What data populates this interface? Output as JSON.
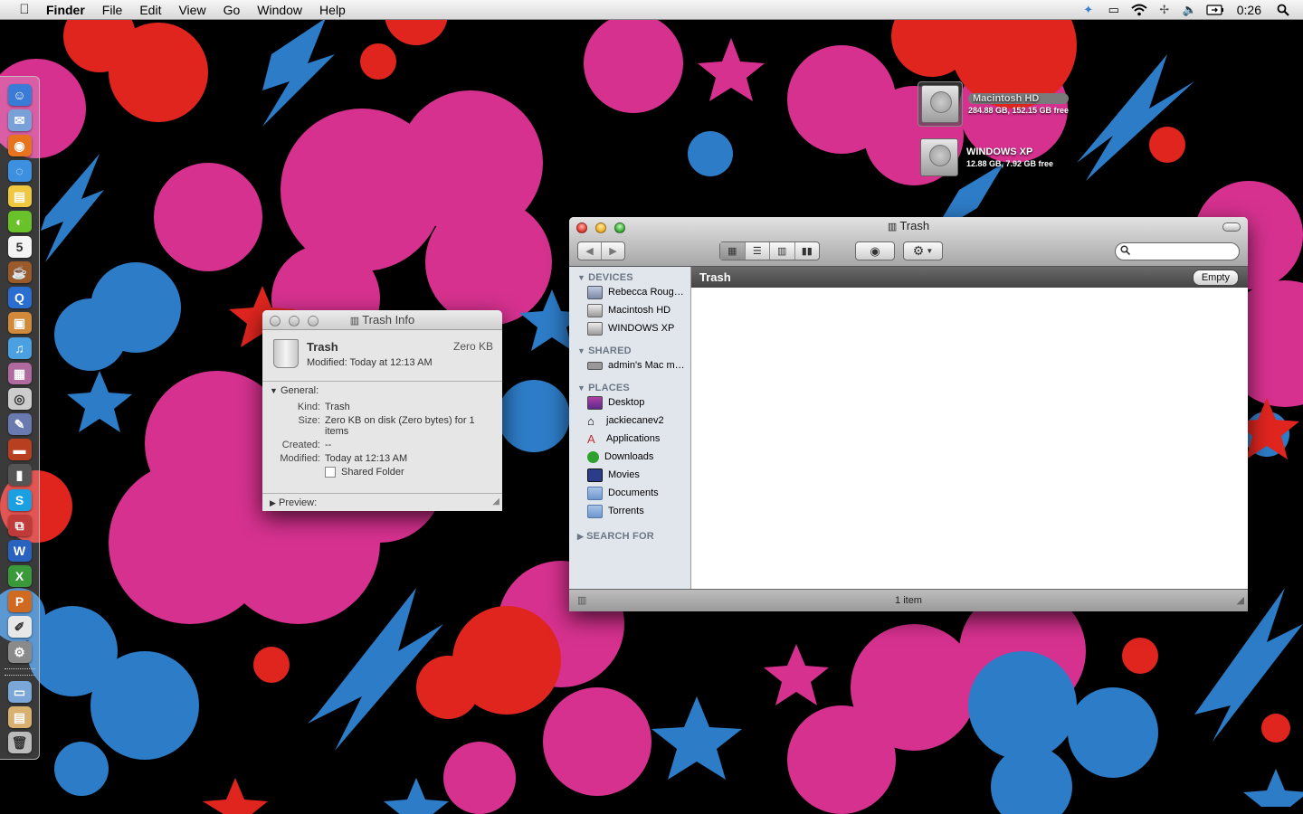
{
  "menubar": {
    "app": "Finder",
    "items": [
      "File",
      "Edit",
      "View",
      "Go",
      "Window",
      "Help"
    ],
    "clock": "0:26",
    "status_icons": [
      "dropbox-icon",
      "display-icon",
      "wifi-icon",
      "bluetooth-icon",
      "volume-icon",
      "battery-icon",
      "spotlight-icon"
    ]
  },
  "desktop": {
    "drives": [
      {
        "name": "Macintosh HD",
        "size": "284.88 GB, 152.15 GB free"
      },
      {
        "name": "WINDOWS XP",
        "size": "12.88 GB, 7.92 GB free"
      }
    ]
  },
  "dock": {
    "icons": [
      {
        "name": "finder-icon",
        "glyph": "☺",
        "color": "#3b7bd8"
      },
      {
        "name": "mail-stamp-icon",
        "glyph": "✉",
        "color": "#7aa0d8"
      },
      {
        "name": "firefox-icon",
        "glyph": "◉",
        "color": "#e8731f"
      },
      {
        "name": "ichat-icon",
        "glyph": "◌",
        "color": "#3d8fe0"
      },
      {
        "name": "printer-icon",
        "glyph": "▤",
        "color": "#f0c840"
      },
      {
        "name": "limewire-icon",
        "glyph": "◐",
        "color": "#6ac22a"
      },
      {
        "name": "ical-icon",
        "glyph": "5",
        "color": "#f4f4f4"
      },
      {
        "name": "coffee-icon",
        "glyph": "☕",
        "color": "#9a5a2a"
      },
      {
        "name": "quicktime-icon",
        "glyph": "Q",
        "color": "#2a6ed0"
      },
      {
        "name": "iphoto-icon",
        "glyph": "▣",
        "color": "#d08a3a"
      },
      {
        "name": "itunes-icon",
        "glyph": "♫",
        "color": "#4aa0e0"
      },
      {
        "name": "system-utility-icon",
        "glyph": "▦",
        "color": "#b06aa0"
      },
      {
        "name": "dvd-player-icon",
        "glyph": "◎",
        "color": "#cccccc"
      },
      {
        "name": "preview-icon",
        "glyph": "✎",
        "color": "#6a7ab0"
      },
      {
        "name": "photo-booth-icon",
        "glyph": "▬",
        "color": "#b84020"
      },
      {
        "name": "imovie-icon",
        "glyph": "▮",
        "color": "#555555"
      },
      {
        "name": "skype-icon",
        "glyph": "S",
        "color": "#1aa0e0"
      },
      {
        "name": "vmware-icon",
        "glyph": "⧉",
        "color": "#c03a3a"
      },
      {
        "name": "word-icon",
        "glyph": "W",
        "color": "#2a62c0"
      },
      {
        "name": "excel-icon",
        "glyph": "X",
        "color": "#3a9a3a"
      },
      {
        "name": "powerpoint-icon",
        "glyph": "P",
        "color": "#d06a20"
      },
      {
        "name": "textedit-icon",
        "glyph": "✐",
        "color": "#e8e8e8"
      },
      {
        "name": "system-preferences-icon",
        "glyph": "⚙",
        "color": "#8a8a8a"
      }
    ],
    "stack_icons": [
      {
        "name": "documents-folder-icon",
        "glyph": "▭",
        "color": "#7aa6d8"
      },
      {
        "name": "downloads-stack-icon",
        "glyph": "▤",
        "color": "#d8b070"
      },
      {
        "name": "trash-icon",
        "glyph": "🗑",
        "color": "#bbbbbb"
      }
    ]
  },
  "info_window": {
    "title": "Trash Info",
    "name": "Trash",
    "size": "Zero KB",
    "modified_line": "Modified: Today at 12:13 AM",
    "general_label": "General:",
    "kind_label": "Kind:",
    "kind": "Trash",
    "size_label": "Size:",
    "size_value": "Zero KB on disk (Zero bytes) for 1 items",
    "created_label": "Created:",
    "created": "--",
    "modified_label": "Modified:",
    "modified": "Today at 12:13 AM",
    "shared_folder_label": "Shared Folder",
    "preview_label": "Preview:"
  },
  "finder": {
    "title": "Trash",
    "path_title": "Trash",
    "empty_button": "Empty",
    "search_placeholder": "",
    "status": "1 item",
    "sidebar": {
      "devices_label": "DEVICES",
      "devices": [
        "Rebecca Roug…",
        "Macintosh HD",
        "WINDOWS XP"
      ],
      "shared_label": "SHARED",
      "shared": [
        "admin's Mac m…"
      ],
      "places_label": "PLACES",
      "places": [
        "Desktop",
        "jackiecanev2",
        "Applications",
        "Downloads",
        "Movies",
        "Documents",
        "Torrents"
      ],
      "search_label": "SEARCH FOR"
    }
  },
  "colors": {
    "wallpaper_bg": "#000000",
    "pink": "#d6318f",
    "red": "#e0251f",
    "blue": "#2d7cc7",
    "close": "#e2443a",
    "minimize": "#f2b630",
    "zoom": "#3fb43d"
  }
}
